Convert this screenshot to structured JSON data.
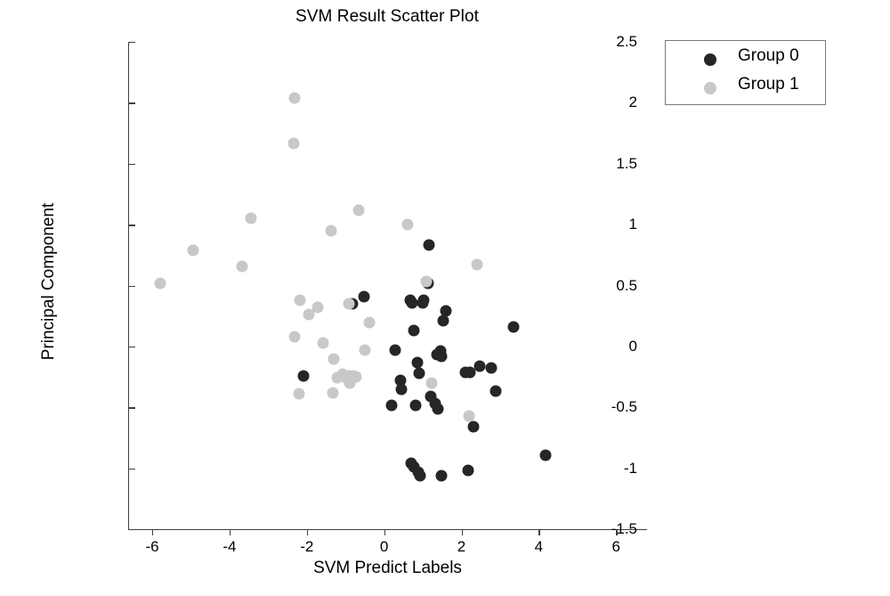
{
  "chart_data": {
    "type": "scatter",
    "title": "SVM Result Scatter Plot",
    "xlabel": "SVM Predict Labels",
    "ylabel": "Principal Component",
    "xlim": [
      -6.6,
      6.8
    ],
    "ylim": [
      -1.5,
      2.5
    ],
    "xticks": [
      -6,
      -4,
      -2,
      0,
      2,
      4,
      6
    ],
    "xticklabels": [
      "-6",
      "-4",
      "-2",
      "0",
      "2",
      "4",
      "6"
    ],
    "yticks": [
      -1.5,
      -1,
      -0.5,
      0,
      0.5,
      1,
      1.5,
      2,
      2.5
    ],
    "yticklabels": [
      "-1.5",
      "-1",
      "-0.5",
      "0",
      "0.5",
      "1",
      "1.5",
      "2",
      "2.5"
    ],
    "grid": false,
    "legend_position": "upper right",
    "marker_size_px": 13,
    "colors": {
      "group0": "#262626",
      "group1": "#c8c8c8",
      "axis": "#404040",
      "background": "#ffffff",
      "legend_border": "#7a7a7a"
    },
    "series": [
      {
        "name": "Group 0",
        "color": "#262626",
        "points": [
          [
            1.15,
            0.83
          ],
          [
            1.13,
            0.52
          ],
          [
            1.02,
            0.38
          ],
          [
            1.0,
            0.36
          ],
          [
            0.68,
            0.38
          ],
          [
            0.72,
            0.36
          ],
          [
            -0.52,
            0.41
          ],
          [
            -0.83,
            0.35
          ],
          [
            1.6,
            0.29
          ],
          [
            1.52,
            0.21
          ],
          [
            3.34,
            0.16
          ],
          [
            0.76,
            0.13
          ],
          [
            1.45,
            -0.04
          ],
          [
            1.47,
            -0.08
          ],
          [
            1.37,
            -0.07
          ],
          [
            0.28,
            -0.03
          ],
          [
            2.1,
            -0.21
          ],
          [
            -2.08,
            -0.24
          ],
          [
            0.86,
            -0.13
          ],
          [
            0.9,
            -0.22
          ],
          [
            2.46,
            -0.16
          ],
          [
            2.77,
            -0.18
          ],
          [
            2.22,
            -0.21
          ],
          [
            0.42,
            -0.28
          ],
          [
            0.45,
            -0.35
          ],
          [
            1.2,
            -0.41
          ],
          [
            2.88,
            -0.37
          ],
          [
            1.32,
            -0.47
          ],
          [
            1.38,
            -0.51
          ],
          [
            0.82,
            -0.48
          ],
          [
            0.2,
            -0.48
          ],
          [
            2.32,
            -0.66
          ],
          [
            0.7,
            -0.96
          ],
          [
            0.76,
            -0.99
          ],
          [
            0.88,
            -1.03
          ],
          [
            0.92,
            -1.06
          ],
          [
            1.48,
            -1.06
          ],
          [
            2.18,
            -1.02
          ],
          [
            4.18,
            -0.89
          ]
        ]
      },
      {
        "name": "Group 1",
        "color": "#c8c8c8",
        "points": [
          [
            -2.32,
            2.04
          ],
          [
            -2.33,
            1.67
          ],
          [
            -3.45,
            1.05
          ],
          [
            -0.66,
            1.12
          ],
          [
            -4.95,
            0.79
          ],
          [
            -1.38,
            0.95
          ],
          [
            0.6,
            1.0
          ],
          [
            -3.68,
            0.66
          ],
          [
            -5.79,
            0.52
          ],
          [
            2.4,
            0.67
          ],
          [
            1.1,
            0.53
          ],
          [
            -2.18,
            0.38
          ],
          [
            -1.73,
            0.32
          ],
          [
            -1.95,
            0.26
          ],
          [
            -0.92,
            0.35
          ],
          [
            -0.38,
            0.2
          ],
          [
            -2.32,
            0.08
          ],
          [
            -1.58,
            0.03
          ],
          [
            -1.3,
            -0.1
          ],
          [
            -0.51,
            -0.03
          ],
          [
            -1.07,
            -0.23
          ],
          [
            -1.02,
            -0.25
          ],
          [
            -0.92,
            -0.24
          ],
          [
            -0.8,
            -0.24
          ],
          [
            -0.88,
            -0.3
          ],
          [
            -1.22,
            -0.26
          ],
          [
            -0.74,
            -0.25
          ],
          [
            -1.32,
            -0.38
          ],
          [
            -2.2,
            -0.39
          ],
          [
            1.22,
            -0.3
          ],
          [
            2.2,
            -0.57
          ]
        ]
      }
    ]
  },
  "legend": {
    "entries": [
      {
        "label": "Group 0"
      },
      {
        "label": "Group 1"
      }
    ]
  }
}
